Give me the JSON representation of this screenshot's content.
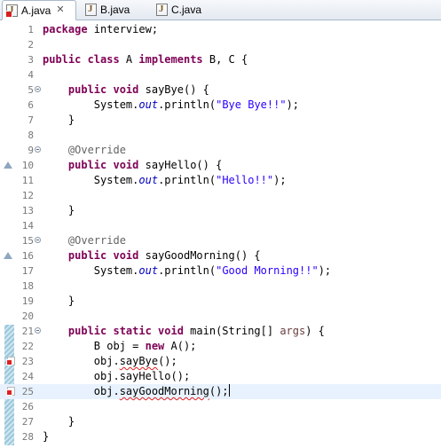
{
  "tabs": [
    {
      "label": "A.java",
      "active": true,
      "closable": true,
      "has_error": true
    },
    {
      "label": "B.java",
      "active": false,
      "closable": false,
      "has_error": false
    },
    {
      "label": "C.java",
      "active": false,
      "closable": false,
      "has_error": false
    }
  ],
  "editor": {
    "current_line": 25,
    "lines": [
      {
        "num": "1",
        "tokens": [
          [
            "keyword",
            "package"
          ],
          [
            "plain",
            " interview;"
          ]
        ]
      },
      {
        "num": "2",
        "tokens": []
      },
      {
        "num": "3",
        "tokens": [
          [
            "keyword",
            "public class"
          ],
          [
            "plain",
            " A "
          ],
          [
            "keyword",
            "implements"
          ],
          [
            "plain",
            " B, C {"
          ]
        ]
      },
      {
        "num": "4",
        "tokens": []
      },
      {
        "num": "5",
        "fold": true,
        "tokens": [
          [
            "plain",
            "    "
          ],
          [
            "keyword",
            "public void"
          ],
          [
            "plain",
            " sayBye() {"
          ]
        ]
      },
      {
        "num": "6",
        "tokens": [
          [
            "plain",
            "        System."
          ],
          [
            "field",
            "out"
          ],
          [
            "plain",
            ".println("
          ],
          [
            "string",
            "\"Bye Bye!!\""
          ],
          [
            "plain",
            ");"
          ]
        ]
      },
      {
        "num": "7",
        "tokens": [
          [
            "plain",
            "    }"
          ]
        ]
      },
      {
        "num": "8",
        "tokens": []
      },
      {
        "num": "9",
        "fold": true,
        "tokens": [
          [
            "plain",
            "    "
          ],
          [
            "annotation",
            "@Override"
          ]
        ]
      },
      {
        "num": "10",
        "override": true,
        "tokens": [
          [
            "plain",
            "    "
          ],
          [
            "keyword",
            "public void"
          ],
          [
            "plain",
            " sayHello() {"
          ]
        ]
      },
      {
        "num": "11",
        "tokens": [
          [
            "plain",
            "        System."
          ],
          [
            "field",
            "out"
          ],
          [
            "plain",
            ".println("
          ],
          [
            "string",
            "\"Hello!!\""
          ],
          [
            "plain",
            ");"
          ]
        ]
      },
      {
        "num": "12",
        "tokens": []
      },
      {
        "num": "13",
        "tokens": [
          [
            "plain",
            "    }"
          ]
        ]
      },
      {
        "num": "14",
        "tokens": []
      },
      {
        "num": "15",
        "fold": true,
        "tokens": [
          [
            "plain",
            "    "
          ],
          [
            "annotation",
            "@Override"
          ]
        ]
      },
      {
        "num": "16",
        "override": true,
        "tokens": [
          [
            "plain",
            "    "
          ],
          [
            "keyword",
            "public void"
          ],
          [
            "plain",
            " sayGoodMorning() {"
          ]
        ]
      },
      {
        "num": "17",
        "tokens": [
          [
            "plain",
            "        System."
          ],
          [
            "field",
            "out"
          ],
          [
            "plain",
            ".println("
          ],
          [
            "string",
            "\"Good Morning!!\""
          ],
          [
            "plain",
            ");"
          ]
        ]
      },
      {
        "num": "18",
        "tokens": []
      },
      {
        "num": "19",
        "tokens": [
          [
            "plain",
            "    }"
          ]
        ]
      },
      {
        "num": "20",
        "tokens": []
      },
      {
        "num": "21",
        "fold": true,
        "tokens": [
          [
            "plain",
            "    "
          ],
          [
            "keyword",
            "public static void"
          ],
          [
            "plain",
            " main(String[] "
          ],
          [
            "param",
            "args"
          ],
          [
            "plain",
            ") {"
          ]
        ]
      },
      {
        "num": "22",
        "tokens": [
          [
            "plain",
            "        B obj = "
          ],
          [
            "keyword",
            "new"
          ],
          [
            "plain",
            " A();"
          ]
        ]
      },
      {
        "num": "23",
        "error": true,
        "tokens": [
          [
            "plain",
            "        obj."
          ],
          [
            "error",
            "sayBye"
          ],
          [
            "plain",
            "();"
          ]
        ]
      },
      {
        "num": "24",
        "tokens": [
          [
            "plain",
            "        obj.sayHello();"
          ]
        ]
      },
      {
        "num": "25",
        "error": true,
        "caret": true,
        "tokens": [
          [
            "plain",
            "        obj."
          ],
          [
            "error",
            "sayGoodMorning"
          ],
          [
            "plain",
            "();"
          ]
        ]
      },
      {
        "num": "26",
        "tokens": []
      },
      {
        "num": "27",
        "tokens": [
          [
            "plain",
            "    }"
          ]
        ]
      },
      {
        "num": "28",
        "tokens": [
          [
            "plain",
            "}"
          ]
        ]
      }
    ]
  },
  "icons": {
    "file": "java-file-icon",
    "fold": "fold-collapse-icon",
    "override": "override-indicator-icon",
    "error": "error-marker-icon",
    "close": "close-icon"
  },
  "colors": {
    "keyword": "#7f0055",
    "string": "#2a00ff",
    "field": "#0000c0",
    "annotation": "#646464",
    "line_number": "#787878",
    "current_line": "#e8f2fe",
    "error": "#e01e1e"
  }
}
